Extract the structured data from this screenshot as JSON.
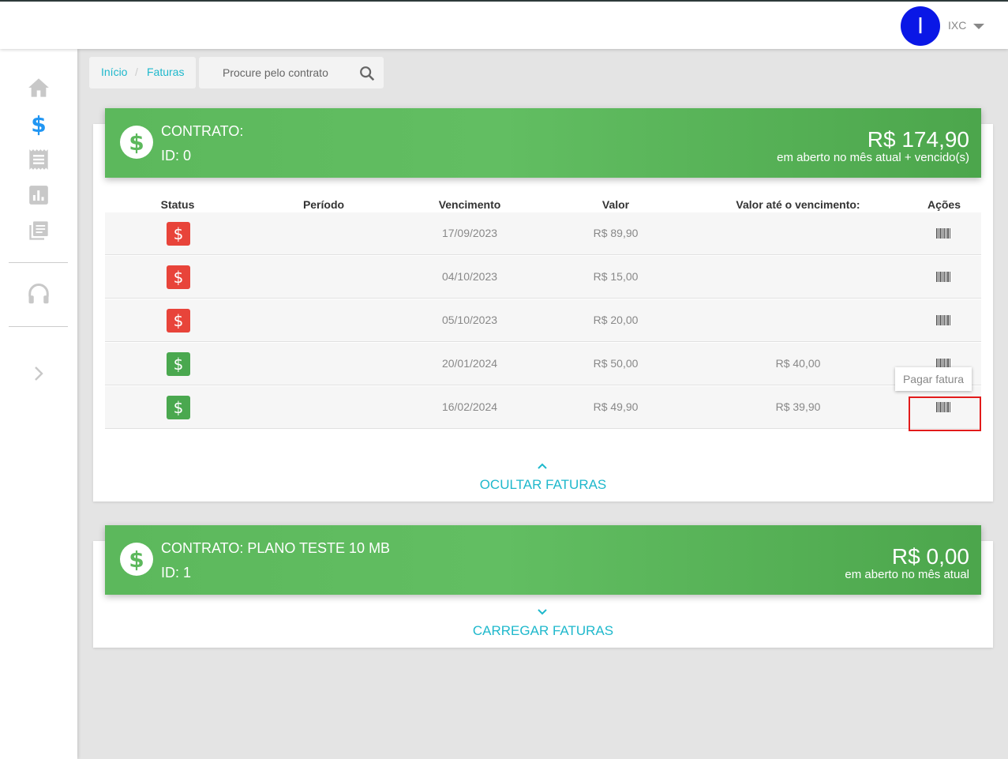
{
  "header": {
    "avatar_letter": "I",
    "username": "IXC",
    "caret_icon": "caret-down-icon"
  },
  "sidebar": {
    "items": [
      {
        "name": "home",
        "icon": "home-icon",
        "active": false
      },
      {
        "name": "invoices",
        "icon": "dollar-icon",
        "active": true
      },
      {
        "name": "receipts",
        "icon": "receipt-icon",
        "active": false
      },
      {
        "name": "reports",
        "icon": "chart-icon",
        "active": false
      },
      {
        "name": "library",
        "icon": "library-icon",
        "active": false
      },
      {
        "name": "support",
        "icon": "headset-icon",
        "active": false
      },
      {
        "name": "expand",
        "icon": "chevron-right-icon",
        "active": false
      }
    ]
  },
  "breadcrumb": {
    "home": "Início",
    "separator": "/",
    "current": "Faturas"
  },
  "search": {
    "placeholder": "Procure pelo contrato"
  },
  "contracts": [
    {
      "title": "CONTRATO:",
      "id_label": "ID: 0",
      "amount": "R$ 174,90",
      "amount_subtitle": "em aberto no mês atual + vencido(s)",
      "table": {
        "headers": [
          "Status",
          "Período",
          "Vencimento",
          "Valor",
          "Valor até o vencimento:",
          "Ações"
        ],
        "rows": [
          {
            "status": "overdue",
            "status_symbol": "$",
            "period": "",
            "due_date": "17/09/2023",
            "value": "R$ 89,90",
            "value_until_due": ""
          },
          {
            "status": "overdue",
            "status_symbol": "$",
            "period": "",
            "due_date": "04/10/2023",
            "value": "R$ 15,00",
            "value_until_due": ""
          },
          {
            "status": "overdue",
            "status_symbol": "$",
            "period": "",
            "due_date": "05/10/2023",
            "value": "R$ 20,00",
            "value_until_due": ""
          },
          {
            "status": "open",
            "status_symbol": "$",
            "period": "",
            "due_date": "20/01/2024",
            "value": "R$ 50,00",
            "value_until_due": "R$ 40,00"
          },
          {
            "status": "open",
            "status_symbol": "$",
            "period": "",
            "due_date": "16/02/2024",
            "value": "R$ 49,90",
            "value_until_due": "R$ 39,90"
          }
        ]
      },
      "tooltip": "Pagar fatura",
      "toggle_label": "OCULTAR FATURAS"
    },
    {
      "title": "CONTRATO: PLANO TESTE 10 MB",
      "id_label": "ID: 1",
      "amount": "R$ 0,00",
      "amount_subtitle": "em aberto no mês atual",
      "toggle_label": "CARREGAR FATURAS"
    }
  ],
  "colors": {
    "accent": "#1eb8cc",
    "banner_green": "#5cb85c",
    "status_overdue": "#e8443a",
    "status_open": "#4aa84f",
    "avatar": "#0a17e6",
    "highlight": "#e21b1b"
  }
}
